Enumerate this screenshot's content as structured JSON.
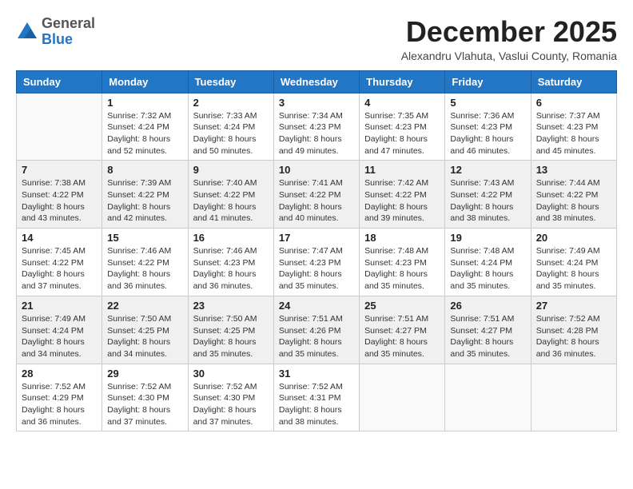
{
  "header": {
    "logo_general": "General",
    "logo_blue": "Blue",
    "month_year": "December 2025",
    "location": "Alexandru Vlahuta, Vaslui County, Romania"
  },
  "days_of_week": [
    "Sunday",
    "Monday",
    "Tuesday",
    "Wednesday",
    "Thursday",
    "Friday",
    "Saturday"
  ],
  "weeks": [
    [
      {
        "day": "",
        "sunrise": "",
        "sunset": "",
        "daylight": ""
      },
      {
        "day": "1",
        "sunrise": "Sunrise: 7:32 AM",
        "sunset": "Sunset: 4:24 PM",
        "daylight": "Daylight: 8 hours and 52 minutes."
      },
      {
        "day": "2",
        "sunrise": "Sunrise: 7:33 AM",
        "sunset": "Sunset: 4:24 PM",
        "daylight": "Daylight: 8 hours and 50 minutes."
      },
      {
        "day": "3",
        "sunrise": "Sunrise: 7:34 AM",
        "sunset": "Sunset: 4:23 PM",
        "daylight": "Daylight: 8 hours and 49 minutes."
      },
      {
        "day": "4",
        "sunrise": "Sunrise: 7:35 AM",
        "sunset": "Sunset: 4:23 PM",
        "daylight": "Daylight: 8 hours and 47 minutes."
      },
      {
        "day": "5",
        "sunrise": "Sunrise: 7:36 AM",
        "sunset": "Sunset: 4:23 PM",
        "daylight": "Daylight: 8 hours and 46 minutes."
      },
      {
        "day": "6",
        "sunrise": "Sunrise: 7:37 AM",
        "sunset": "Sunset: 4:23 PM",
        "daylight": "Daylight: 8 hours and 45 minutes."
      }
    ],
    [
      {
        "day": "7",
        "sunrise": "Sunrise: 7:38 AM",
        "sunset": "Sunset: 4:22 PM",
        "daylight": "Daylight: 8 hours and 43 minutes."
      },
      {
        "day": "8",
        "sunrise": "Sunrise: 7:39 AM",
        "sunset": "Sunset: 4:22 PM",
        "daylight": "Daylight: 8 hours and 42 minutes."
      },
      {
        "day": "9",
        "sunrise": "Sunrise: 7:40 AM",
        "sunset": "Sunset: 4:22 PM",
        "daylight": "Daylight: 8 hours and 41 minutes."
      },
      {
        "day": "10",
        "sunrise": "Sunrise: 7:41 AM",
        "sunset": "Sunset: 4:22 PM",
        "daylight": "Daylight: 8 hours and 40 minutes."
      },
      {
        "day": "11",
        "sunrise": "Sunrise: 7:42 AM",
        "sunset": "Sunset: 4:22 PM",
        "daylight": "Daylight: 8 hours and 39 minutes."
      },
      {
        "day": "12",
        "sunrise": "Sunrise: 7:43 AM",
        "sunset": "Sunset: 4:22 PM",
        "daylight": "Daylight: 8 hours and 38 minutes."
      },
      {
        "day": "13",
        "sunrise": "Sunrise: 7:44 AM",
        "sunset": "Sunset: 4:22 PM",
        "daylight": "Daylight: 8 hours and 38 minutes."
      }
    ],
    [
      {
        "day": "14",
        "sunrise": "Sunrise: 7:45 AM",
        "sunset": "Sunset: 4:22 PM",
        "daylight": "Daylight: 8 hours and 37 minutes."
      },
      {
        "day": "15",
        "sunrise": "Sunrise: 7:46 AM",
        "sunset": "Sunset: 4:22 PM",
        "daylight": "Daylight: 8 hours and 36 minutes."
      },
      {
        "day": "16",
        "sunrise": "Sunrise: 7:46 AM",
        "sunset": "Sunset: 4:23 PM",
        "daylight": "Daylight: 8 hours and 36 minutes."
      },
      {
        "day": "17",
        "sunrise": "Sunrise: 7:47 AM",
        "sunset": "Sunset: 4:23 PM",
        "daylight": "Daylight: 8 hours and 35 minutes."
      },
      {
        "day": "18",
        "sunrise": "Sunrise: 7:48 AM",
        "sunset": "Sunset: 4:23 PM",
        "daylight": "Daylight: 8 hours and 35 minutes."
      },
      {
        "day": "19",
        "sunrise": "Sunrise: 7:48 AM",
        "sunset": "Sunset: 4:24 PM",
        "daylight": "Daylight: 8 hours and 35 minutes."
      },
      {
        "day": "20",
        "sunrise": "Sunrise: 7:49 AM",
        "sunset": "Sunset: 4:24 PM",
        "daylight": "Daylight: 8 hours and 35 minutes."
      }
    ],
    [
      {
        "day": "21",
        "sunrise": "Sunrise: 7:49 AM",
        "sunset": "Sunset: 4:24 PM",
        "daylight": "Daylight: 8 hours and 34 minutes."
      },
      {
        "day": "22",
        "sunrise": "Sunrise: 7:50 AM",
        "sunset": "Sunset: 4:25 PM",
        "daylight": "Daylight: 8 hours and 34 minutes."
      },
      {
        "day": "23",
        "sunrise": "Sunrise: 7:50 AM",
        "sunset": "Sunset: 4:25 PM",
        "daylight": "Daylight: 8 hours and 35 minutes."
      },
      {
        "day": "24",
        "sunrise": "Sunrise: 7:51 AM",
        "sunset": "Sunset: 4:26 PM",
        "daylight": "Daylight: 8 hours and 35 minutes."
      },
      {
        "day": "25",
        "sunrise": "Sunrise: 7:51 AM",
        "sunset": "Sunset: 4:27 PM",
        "daylight": "Daylight: 8 hours and 35 minutes."
      },
      {
        "day": "26",
        "sunrise": "Sunrise: 7:51 AM",
        "sunset": "Sunset: 4:27 PM",
        "daylight": "Daylight: 8 hours and 35 minutes."
      },
      {
        "day": "27",
        "sunrise": "Sunrise: 7:52 AM",
        "sunset": "Sunset: 4:28 PM",
        "daylight": "Daylight: 8 hours and 36 minutes."
      }
    ],
    [
      {
        "day": "28",
        "sunrise": "Sunrise: 7:52 AM",
        "sunset": "Sunset: 4:29 PM",
        "daylight": "Daylight: 8 hours and 36 minutes."
      },
      {
        "day": "29",
        "sunrise": "Sunrise: 7:52 AM",
        "sunset": "Sunset: 4:30 PM",
        "daylight": "Daylight: 8 hours and 37 minutes."
      },
      {
        "day": "30",
        "sunrise": "Sunrise: 7:52 AM",
        "sunset": "Sunset: 4:30 PM",
        "daylight": "Daylight: 8 hours and 37 minutes."
      },
      {
        "day": "31",
        "sunrise": "Sunrise: 7:52 AM",
        "sunset": "Sunset: 4:31 PM",
        "daylight": "Daylight: 8 hours and 38 minutes."
      },
      {
        "day": "",
        "sunrise": "",
        "sunset": "",
        "daylight": ""
      },
      {
        "day": "",
        "sunrise": "",
        "sunset": "",
        "daylight": ""
      },
      {
        "day": "",
        "sunrise": "",
        "sunset": "",
        "daylight": ""
      }
    ]
  ]
}
